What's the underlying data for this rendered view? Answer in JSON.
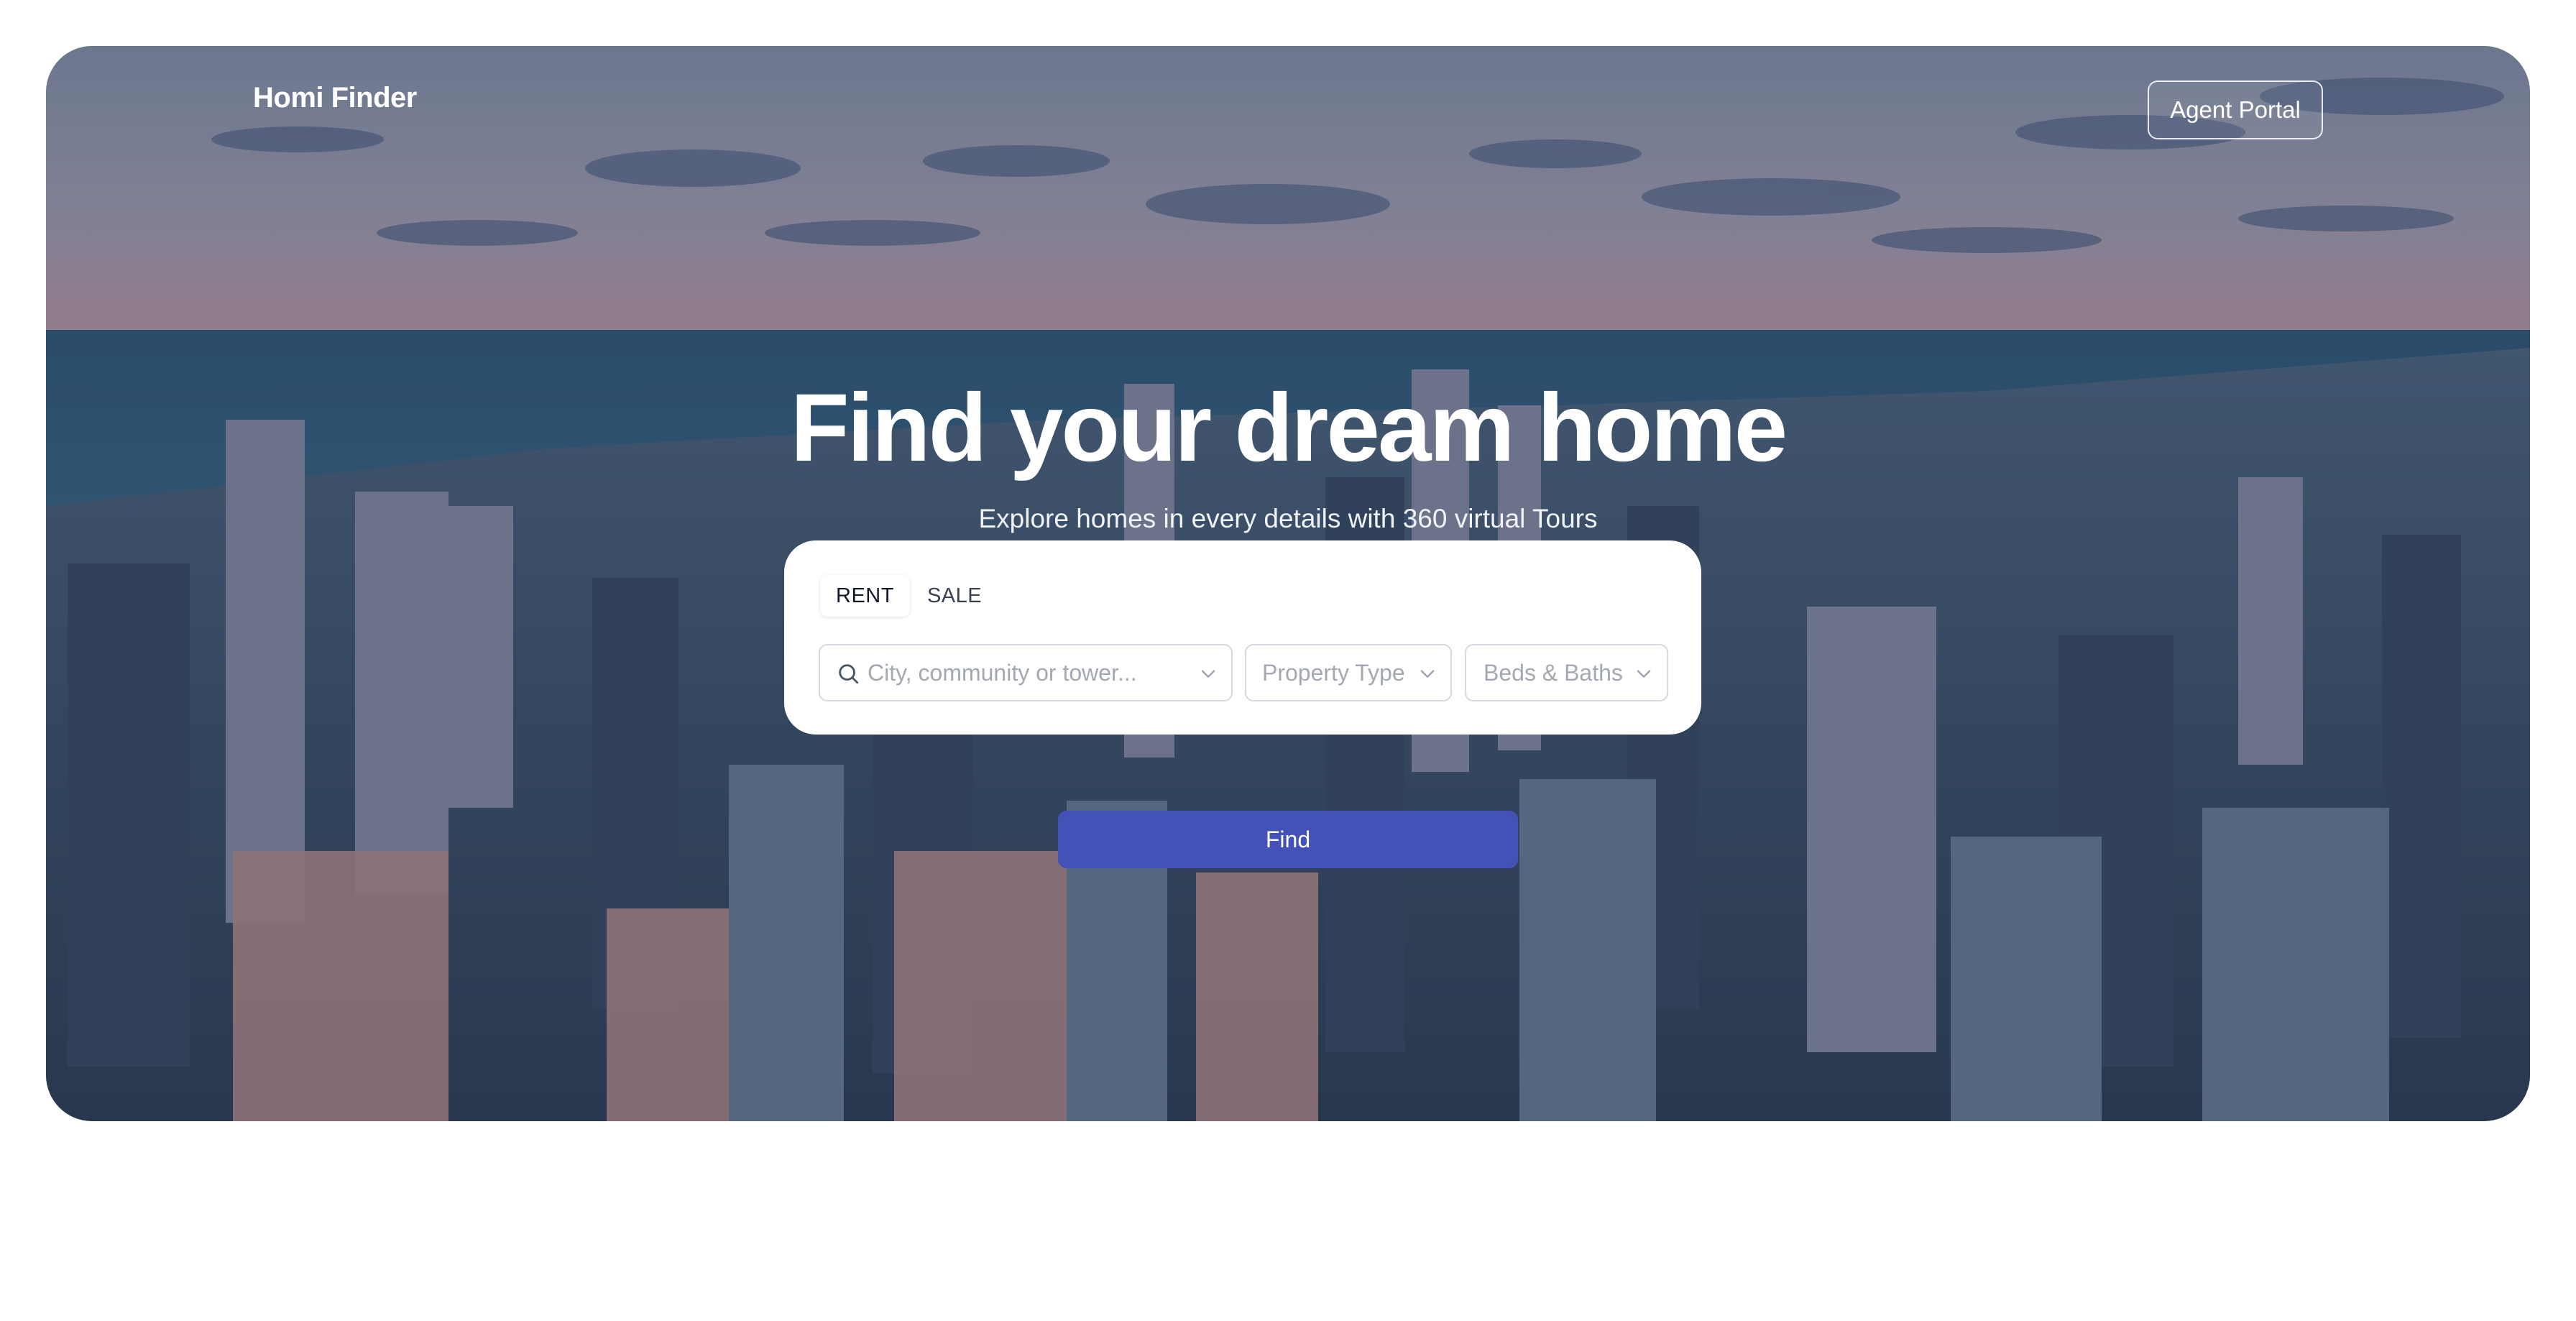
{
  "brand": {
    "name": "Homi Finder"
  },
  "header": {
    "agent_portal_label": "Agent Portal"
  },
  "hero": {
    "headline": "Find your dream home",
    "subheadline": "Explore homes in every details with 360 virtual Tours",
    "background": "aerial-city-skyline-photo"
  },
  "search": {
    "tabs": [
      {
        "label": "RENT",
        "active": true
      },
      {
        "label": "SALE",
        "active": false
      }
    ],
    "location_placeholder": "City, community or tower...",
    "location_value": "",
    "property_type_placeholder": "Property Type",
    "beds_baths_placeholder": "Beds & Baths",
    "find_label": "Find"
  },
  "colors": {
    "accent": "#4452b8",
    "hero_overlay": "#1e2846",
    "card": "#ffffff"
  },
  "icons": {
    "search": "search-icon",
    "dropdown": "chevron-down-icon"
  }
}
